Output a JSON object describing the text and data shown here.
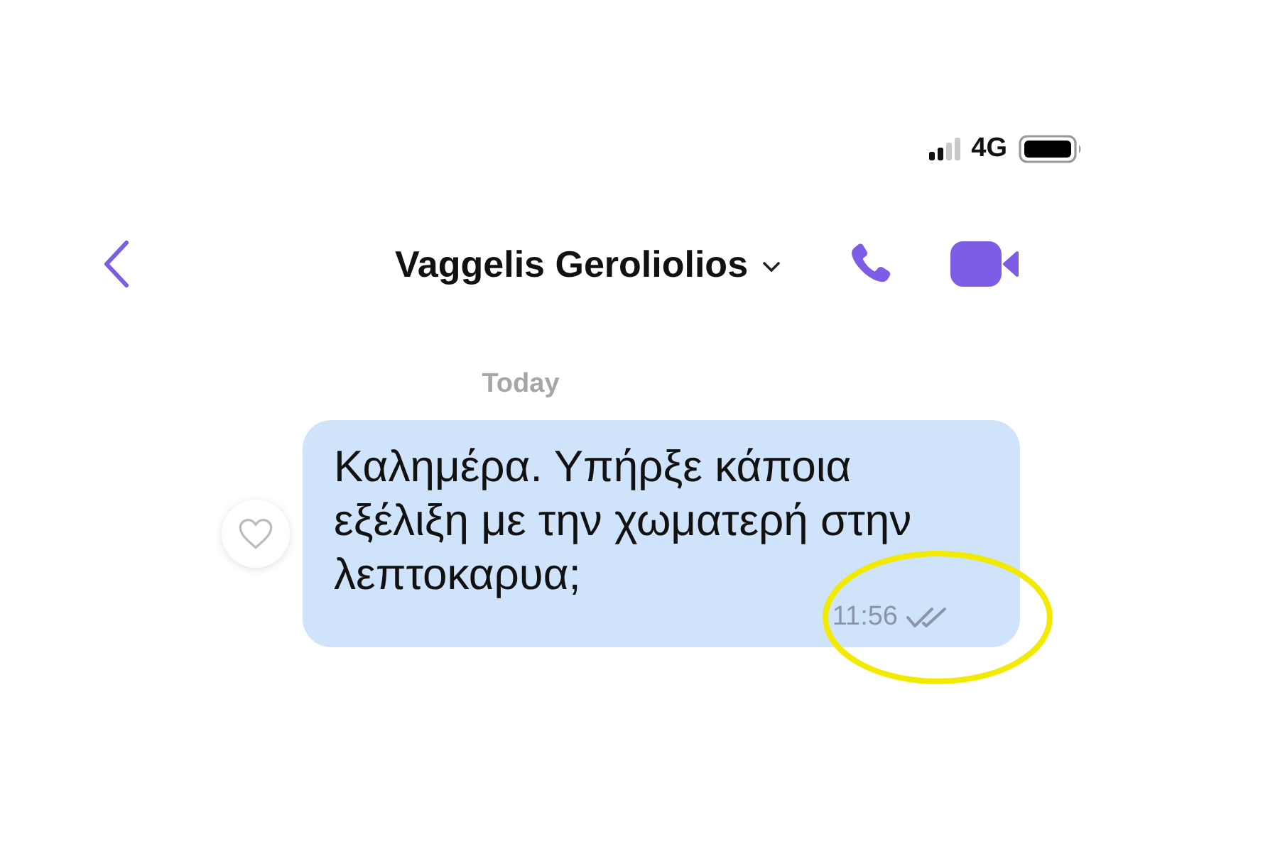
{
  "status_bar": {
    "network": "4G"
  },
  "header": {
    "contact_name": "Vaggelis Geroliolios"
  },
  "chat": {
    "date_separator": "Today",
    "messages": [
      {
        "text": "Καλημέρα. Υπήρξε κάποια εξέλιξη με την χωματερή στην λεπτοκαρυα;",
        "time": "11:56",
        "read": true,
        "liked": false
      }
    ]
  }
}
